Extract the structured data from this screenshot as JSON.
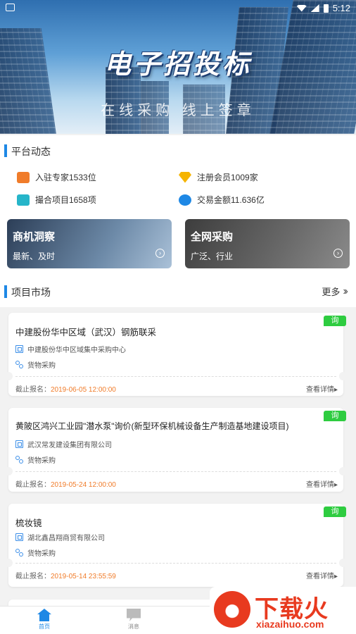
{
  "statusbar": {
    "time": "5:12"
  },
  "banner": {
    "title": "电子招投标",
    "subtitle": "在线采购  线上签章"
  },
  "platform": {
    "title": "平台动态",
    "stats": [
      {
        "icon": "expert-icon",
        "label": "入驻专家1533位",
        "color": "#f07c2a"
      },
      {
        "icon": "member-icon",
        "label": "注册会员1009家",
        "color": "#f5b400"
      },
      {
        "icon": "match-icon",
        "label": "撮合项目1658项",
        "color": "#26b5c9"
      },
      {
        "icon": "money-icon",
        "label": "交易金额11.636亿",
        "color": "#1e88e5"
      }
    ]
  },
  "promos": [
    {
      "title": "商机洞察",
      "sub": "最新、及时"
    },
    {
      "title": "全网采购",
      "sub": "广泛、行业"
    }
  ],
  "market": {
    "title": "项目市场",
    "more": "更多",
    "items": [
      {
        "tag": "询",
        "title": "中建股份华中区域（武汉）钢筋联采",
        "company": "中建股份华中区域集中采购中心",
        "type": "货物采购",
        "deadline_label": "截止报名：",
        "deadline": "2019-06-05 12:00:00",
        "detail": "查看详情▸"
      },
      {
        "tag": "询",
        "title": "黄陂区鸿兴工业园\"潜水泵\"询价(新型环保机械设备生产制造基地建设项目)",
        "company": "武汉常发建设集团有限公司",
        "type": "货物采购",
        "deadline_label": "截止报名：",
        "deadline": "2019-05-24 12:00:00",
        "detail": "查看详情▸"
      },
      {
        "tag": "询",
        "title": "梳妆镜",
        "company": "湖北鑫昌翔商贸有限公司",
        "type": "货物采购",
        "deadline_label": "截止报名：",
        "deadline": "2019-05-14 23:55:59",
        "detail": "查看详情▸"
      }
    ]
  },
  "nav": {
    "home": "首页",
    "messages": "消息"
  },
  "watermark": {
    "main": "下载火",
    "sub": "xiazaihuo.com"
  },
  "colors": {
    "accent": "#1e88e5",
    "tag": "#2ecc40",
    "deadline": "#f07c2a"
  }
}
